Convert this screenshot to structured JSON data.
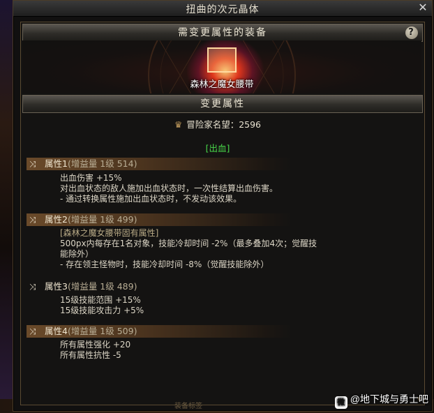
{
  "window": {
    "title": "扭曲的次元晶体",
    "close_label": "✕"
  },
  "equipment_section": {
    "banner": "需变更属性的装备",
    "help_label": "?",
    "item_name": "森林之魔女腰带"
  },
  "change_section": {
    "banner": "变更属性",
    "reputation_icon": "crown-icon",
    "reputation_label": "冒险家名望：2596",
    "tag": "[出血]"
  },
  "attributes": [
    {
      "header": "属性1",
      "meta": "(增益量 1级 514)",
      "lines": [
        "出血伤害 +15%",
        "对出血状态的敌人施加出血状态时，一次性结算出血伤害。",
        "- 通过转换属性施加出血状态时，不发动该效果。"
      ]
    },
    {
      "header": "属性2",
      "meta": "(增益量 1级 499)",
      "bracket": "[森林之魔女腰带固有属性]",
      "lines": [
        "500px内每存在1名对象，技能冷却时间 -2%（最多叠加4次；觉醒技",
        "能除外）",
        "- 存在领主怪物时，技能冷却时间 -8%（觉醒技能除外）"
      ]
    },
    {
      "header": "属性3",
      "meta": "(增益量 1级 489)",
      "lines": [
        "15级技能范围 +15%",
        "15级技能攻击力 +5%"
      ]
    },
    {
      "header": "属性4",
      "meta": "(增益量 1级 509)",
      "lines": [
        "所有属性强化 +20",
        "所有属性抗性 -5"
      ]
    }
  ],
  "footer": {
    "bottom_text": "装备标签"
  },
  "watermark": {
    "logo": "微",
    "text": "@地下城与勇士吧"
  },
  "colors": {
    "tag_green": "#49d84a",
    "header_brown": "#6a4a2a",
    "glow_red": "#ff3c1e"
  }
}
